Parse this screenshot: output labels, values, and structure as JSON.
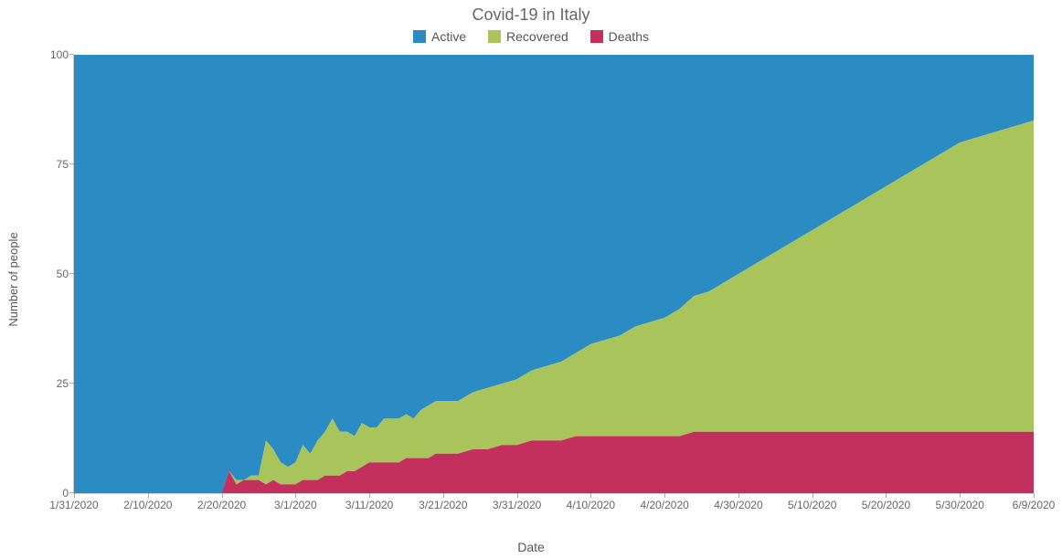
{
  "chart_data": {
    "type": "area",
    "stacked": true,
    "stack_mode": "100%",
    "title": "Covid-19 in Italy",
    "xlabel": "Date",
    "ylabel": "Number of people",
    "ylim": [
      0,
      100
    ],
    "yticks": [
      0,
      25,
      50,
      75,
      100
    ],
    "xticks": [
      "1/31/2020",
      "2/10/2020",
      "2/20/2020",
      "3/1/2020",
      "3/11/2020",
      "3/21/2020",
      "3/31/2020",
      "4/10/2020",
      "4/20/2020",
      "4/30/2020",
      "5/10/2020",
      "5/20/2020",
      "5/30/2020",
      "6/9/2020"
    ],
    "series": [
      {
        "name": "Active",
        "color": "#2b8cc4"
      },
      {
        "name": "Recovered",
        "color": "#a9c45b"
      },
      {
        "name": "Deaths",
        "color": "#c4305d"
      }
    ],
    "data": [
      {
        "date": "1/31/2020",
        "deaths": 0,
        "recovered": 0,
        "active": 100
      },
      {
        "date": "2/10/2020",
        "deaths": 0,
        "recovered": 0,
        "active": 100
      },
      {
        "date": "2/18/2020",
        "deaths": 0,
        "recovered": 0,
        "active": 100
      },
      {
        "date": "2/20/2020",
        "deaths": 0,
        "recovered": 0,
        "active": 100
      },
      {
        "date": "2/21/2020",
        "deaths": 5,
        "recovered": 0,
        "active": 95
      },
      {
        "date": "2/22/2020",
        "deaths": 2,
        "recovered": 1,
        "active": 97
      },
      {
        "date": "2/23/2020",
        "deaths": 3,
        "recovered": 0,
        "active": 97
      },
      {
        "date": "2/24/2020",
        "deaths": 3,
        "recovered": 1,
        "active": 96
      },
      {
        "date": "2/25/2020",
        "deaths": 3,
        "recovered": 1,
        "active": 96
      },
      {
        "date": "2/26/2020",
        "deaths": 2,
        "recovered": 10,
        "active": 88
      },
      {
        "date": "2/27/2020",
        "deaths": 3,
        "recovered": 7,
        "active": 90
      },
      {
        "date": "2/28/2020",
        "deaths": 2,
        "recovered": 5,
        "active": 93
      },
      {
        "date": "2/29/2020",
        "deaths": 2,
        "recovered": 4,
        "active": 94
      },
      {
        "date": "3/1/2020",
        "deaths": 2,
        "recovered": 5,
        "active": 93
      },
      {
        "date": "3/2/2020",
        "deaths": 3,
        "recovered": 8,
        "active": 89
      },
      {
        "date": "3/3/2020",
        "deaths": 3,
        "recovered": 6,
        "active": 91
      },
      {
        "date": "3/4/2020",
        "deaths": 3,
        "recovered": 9,
        "active": 88
      },
      {
        "date": "3/5/2020",
        "deaths": 4,
        "recovered": 10,
        "active": 86
      },
      {
        "date": "3/6/2020",
        "deaths": 4,
        "recovered": 13,
        "active": 83
      },
      {
        "date": "3/7/2020",
        "deaths": 4,
        "recovered": 10,
        "active": 86
      },
      {
        "date": "3/8/2020",
        "deaths": 5,
        "recovered": 9,
        "active": 86
      },
      {
        "date": "3/9/2020",
        "deaths": 5,
        "recovered": 8,
        "active": 87
      },
      {
        "date": "3/10/2020",
        "deaths": 6,
        "recovered": 10,
        "active": 84
      },
      {
        "date": "3/11/2020",
        "deaths": 7,
        "recovered": 8,
        "active": 85
      },
      {
        "date": "3/12/2020",
        "deaths": 7,
        "recovered": 8,
        "active": 85
      },
      {
        "date": "3/13/2020",
        "deaths": 7,
        "recovered": 10,
        "active": 83
      },
      {
        "date": "3/14/2020",
        "deaths": 7,
        "recovered": 10,
        "active": 83
      },
      {
        "date": "3/15/2020",
        "deaths": 7,
        "recovered": 10,
        "active": 83
      },
      {
        "date": "3/16/2020",
        "deaths": 8,
        "recovered": 10,
        "active": 82
      },
      {
        "date": "3/17/2020",
        "deaths": 8,
        "recovered": 9,
        "active": 83
      },
      {
        "date": "3/18/2020",
        "deaths": 8,
        "recovered": 11,
        "active": 81
      },
      {
        "date": "3/19/2020",
        "deaths": 8,
        "recovered": 12,
        "active": 80
      },
      {
        "date": "3/20/2020",
        "deaths": 9,
        "recovered": 12,
        "active": 79
      },
      {
        "date": "3/21/2020",
        "deaths": 9,
        "recovered": 12,
        "active": 79
      },
      {
        "date": "3/23/2020",
        "deaths": 9,
        "recovered": 12,
        "active": 79
      },
      {
        "date": "3/25/2020",
        "deaths": 10,
        "recovered": 13,
        "active": 77
      },
      {
        "date": "3/27/2020",
        "deaths": 10,
        "recovered": 14,
        "active": 76
      },
      {
        "date": "3/29/2020",
        "deaths": 11,
        "recovered": 14,
        "active": 75
      },
      {
        "date": "3/31/2020",
        "deaths": 11,
        "recovered": 15,
        "active": 74
      },
      {
        "date": "4/2/2020",
        "deaths": 12,
        "recovered": 16,
        "active": 72
      },
      {
        "date": "4/4/2020",
        "deaths": 12,
        "recovered": 17,
        "active": 71
      },
      {
        "date": "4/6/2020",
        "deaths": 12,
        "recovered": 18,
        "active": 70
      },
      {
        "date": "4/8/2020",
        "deaths": 13,
        "recovered": 19,
        "active": 68
      },
      {
        "date": "4/10/2020",
        "deaths": 13,
        "recovered": 21,
        "active": 66
      },
      {
        "date": "4/12/2020",
        "deaths": 13,
        "recovered": 22,
        "active": 65
      },
      {
        "date": "4/14/2020",
        "deaths": 13,
        "recovered": 23,
        "active": 64
      },
      {
        "date": "4/16/2020",
        "deaths": 13,
        "recovered": 25,
        "active": 62
      },
      {
        "date": "4/18/2020",
        "deaths": 13,
        "recovered": 26,
        "active": 61
      },
      {
        "date": "4/20/2020",
        "deaths": 13,
        "recovered": 27,
        "active": 60
      },
      {
        "date": "4/22/2020",
        "deaths": 13,
        "recovered": 29,
        "active": 58
      },
      {
        "date": "4/24/2020",
        "deaths": 14,
        "recovered": 31,
        "active": 55
      },
      {
        "date": "4/26/2020",
        "deaths": 14,
        "recovered": 32,
        "active": 54
      },
      {
        "date": "4/28/2020",
        "deaths": 14,
        "recovered": 34,
        "active": 52
      },
      {
        "date": "4/30/2020",
        "deaths": 14,
        "recovered": 36,
        "active": 50
      },
      {
        "date": "5/2/2020",
        "deaths": 14,
        "recovered": 38,
        "active": 48
      },
      {
        "date": "5/4/2020",
        "deaths": 14,
        "recovered": 40,
        "active": 46
      },
      {
        "date": "5/6/2020",
        "deaths": 14,
        "recovered": 42,
        "active": 44
      },
      {
        "date": "5/8/2020",
        "deaths": 14,
        "recovered": 44,
        "active": 42
      },
      {
        "date": "5/10/2020",
        "deaths": 14,
        "recovered": 46,
        "active": 40
      },
      {
        "date": "5/12/2020",
        "deaths": 14,
        "recovered": 48,
        "active": 38
      },
      {
        "date": "5/14/2020",
        "deaths": 14,
        "recovered": 50,
        "active": 36
      },
      {
        "date": "5/16/2020",
        "deaths": 14,
        "recovered": 52,
        "active": 34
      },
      {
        "date": "5/18/2020",
        "deaths": 14,
        "recovered": 54,
        "active": 32
      },
      {
        "date": "5/20/2020",
        "deaths": 14,
        "recovered": 56,
        "active": 30
      },
      {
        "date": "5/22/2020",
        "deaths": 14,
        "recovered": 58,
        "active": 28
      },
      {
        "date": "5/24/2020",
        "deaths": 14,
        "recovered": 60,
        "active": 26
      },
      {
        "date": "5/26/2020",
        "deaths": 14,
        "recovered": 62,
        "active": 24
      },
      {
        "date": "5/28/2020",
        "deaths": 14,
        "recovered": 64,
        "active": 22
      },
      {
        "date": "5/30/2020",
        "deaths": 14,
        "recovered": 66,
        "active": 20
      },
      {
        "date": "6/1/2020",
        "deaths": 14,
        "recovered": 67,
        "active": 19
      },
      {
        "date": "6/3/2020",
        "deaths": 14,
        "recovered": 68,
        "active": 18
      },
      {
        "date": "6/5/2020",
        "deaths": 14,
        "recovered": 69,
        "active": 17
      },
      {
        "date": "6/7/2020",
        "deaths": 14,
        "recovered": 70,
        "active": 16
      },
      {
        "date": "6/9/2020",
        "deaths": 14,
        "recovered": 71,
        "active": 15
      }
    ]
  }
}
